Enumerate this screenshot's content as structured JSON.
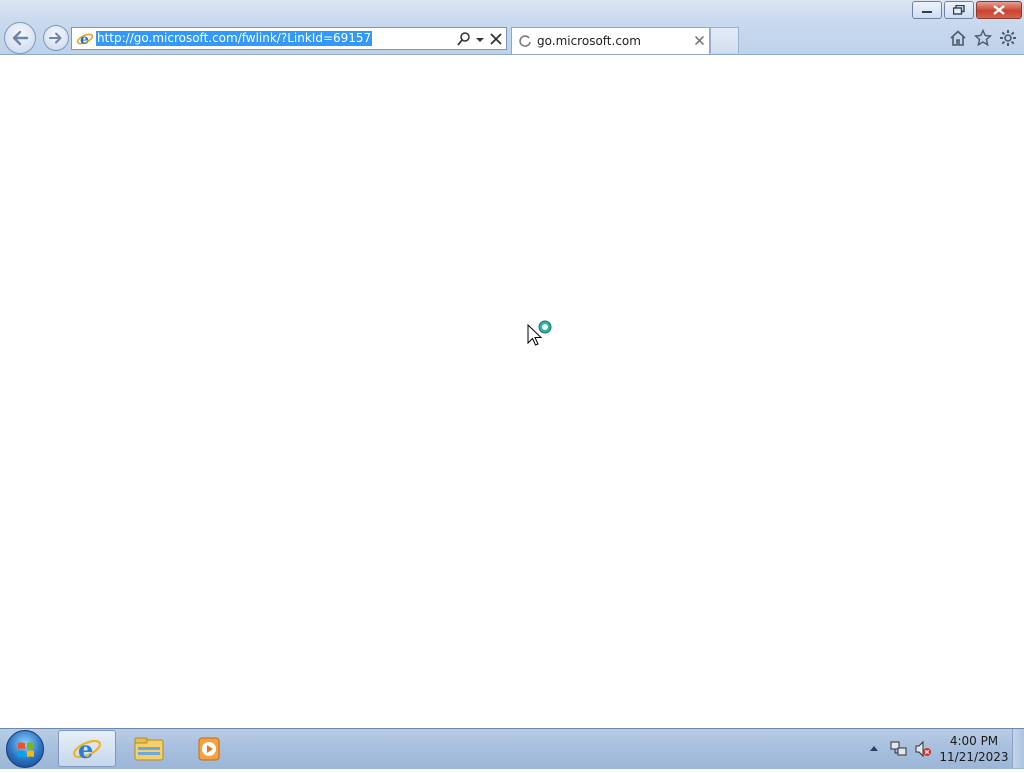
{
  "window": {
    "minimize_icon": "minimize-icon",
    "restore_icon": "restore-icon",
    "close_icon": "close-icon"
  },
  "navigation": {
    "back_icon": "back-arrow-icon",
    "forward_icon": "forward-arrow-icon"
  },
  "address_bar": {
    "url": "http://go.microsoft.com/fwlink/?LinkId=69157",
    "icons": [
      "ie-page-icon",
      "search-icon",
      "dropdown-icon",
      "stop-icon"
    ]
  },
  "tabs": [
    {
      "title": "go.microsoft.com",
      "icon": "loading-spinner-icon",
      "close_icon": "close-icon"
    }
  ],
  "toolbar_icons": [
    "home-icon",
    "favorites-star-icon",
    "tools-gear-icon"
  ],
  "taskbar": {
    "items": [
      "internet-explorer-icon",
      "file-explorer-icon",
      "media-player-icon"
    ],
    "tray_icons": [
      "show-hidden-icons-icon",
      "network-icon",
      "volume-muted-icon"
    ],
    "clock": {
      "time": "4:00 PM",
      "date": "11/21/2023"
    }
  },
  "colors": {
    "selection": "#3399ff",
    "chrome": "#c9d9ee",
    "taskbar": "#a8c0de"
  }
}
